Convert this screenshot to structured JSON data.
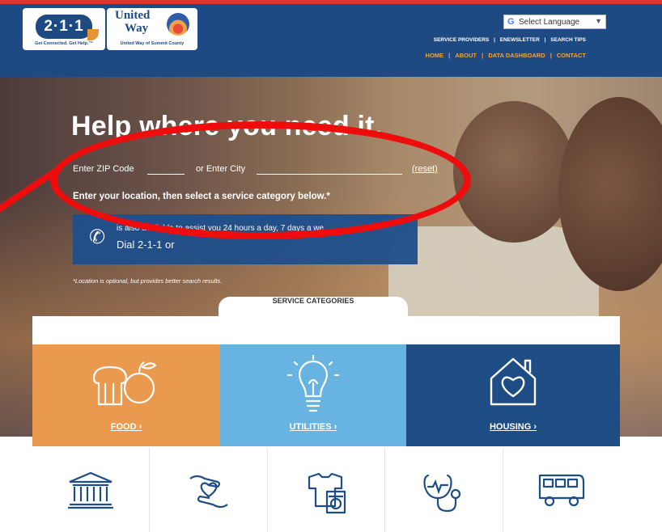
{
  "header": {
    "logo_211": {
      "text": "2·1·1",
      "tagline": "Get Connected. Get Help.™"
    },
    "logo_uw": {
      "line1": "United",
      "line2": "Way",
      "tagline": "United Way of Summit County"
    },
    "language": {
      "g": "G",
      "label": "Select Language",
      "caret": "▼"
    },
    "utility_nav": [
      "SERVICE PROVIDERS",
      "ENEWSLETTER",
      "SEARCH TIPS"
    ],
    "main_nav": [
      "HOME",
      "ABOUT",
      "DATA DASHBOARD",
      "CONTACT"
    ],
    "separator": "|"
  },
  "hero": {
    "title": "Help where you need it.",
    "zip_label": "Enter ZIP Code",
    "zip_value": "",
    "city_label": "or Enter City",
    "city_value": "",
    "reset": "(reset)",
    "instruction": "Enter your location, then select a service category below.*",
    "call_line1": "is also available to assist you 24 hours a day, 7 days a we",
    "call_line2": "Dial  2-1-1  or",
    "note": "*Location is optional, but provides better search results."
  },
  "categories": {
    "tab_title": "SERVICE CATEGORIES",
    "big": [
      {
        "label": "FOOD  ›",
        "icon": "bread-apple-icon"
      },
      {
        "label": "UTILITIES  ›",
        "icon": "lightbulb-icon"
      },
      {
        "label": "HOUSING  ›",
        "icon": "house-heart-icon"
      }
    ],
    "small": [
      {
        "icon": "courthouse-icon"
      },
      {
        "icon": "hands-heart-icon"
      },
      {
        "icon": "clothing-washer-icon"
      },
      {
        "icon": "stethoscope-icon"
      },
      {
        "icon": "bus-icon"
      }
    ]
  },
  "colors": {
    "nav_blue": "#1d4a82",
    "accent_orange": "#f2a33a",
    "food": "#ea9a4e",
    "utilities": "#67b3e1",
    "housing": "#1e4d85",
    "annotation_red": "#ee0d0d"
  }
}
